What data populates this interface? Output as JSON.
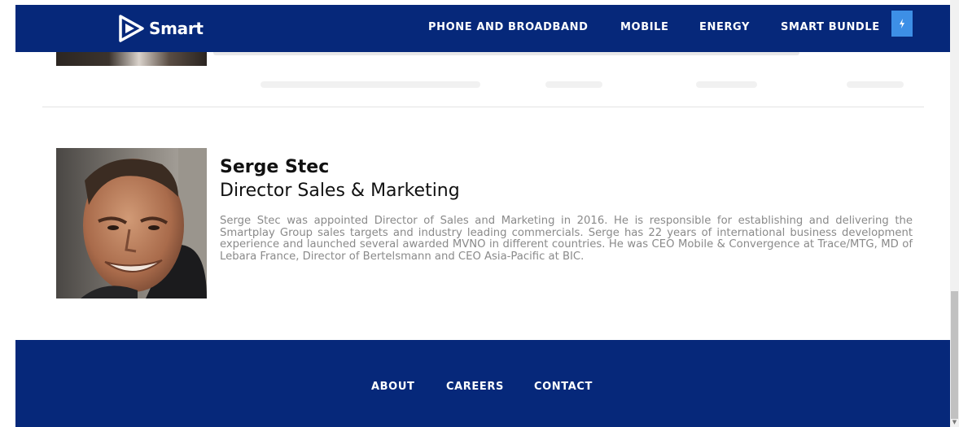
{
  "header": {
    "logo_text": "Smart",
    "nav": [
      {
        "label": "PHONE AND BROADBAND"
      },
      {
        "label": "MOBILE"
      },
      {
        "label": "ENERGY"
      },
      {
        "label": "SMART BUNDLE"
      }
    ],
    "action_icon": "lightning-bolt-icon",
    "colors": {
      "bar": "#06287a",
      "action": "#3d8fe6"
    }
  },
  "member": {
    "name": "Serge Stec",
    "title": "Director Sales & Marketing",
    "bio": "Serge Stec was appointed Director of Sales and Marketing in 2016. He is responsible for establishing and delivering the Smartplay Group sales targets and industry leading commercials. Serge has 22 years of international business development experience and launched several awarded MVNO in different countries. He was CEO Mobile & Convergence at Trace/MTG,  MD of Lebara France, Director of Bertelsmann and CEO Asia-Pacific at BIC."
  },
  "footer": {
    "links": [
      {
        "label": "ABOUT"
      },
      {
        "label": "CAREERS"
      },
      {
        "label": "CONTACT"
      }
    ]
  }
}
